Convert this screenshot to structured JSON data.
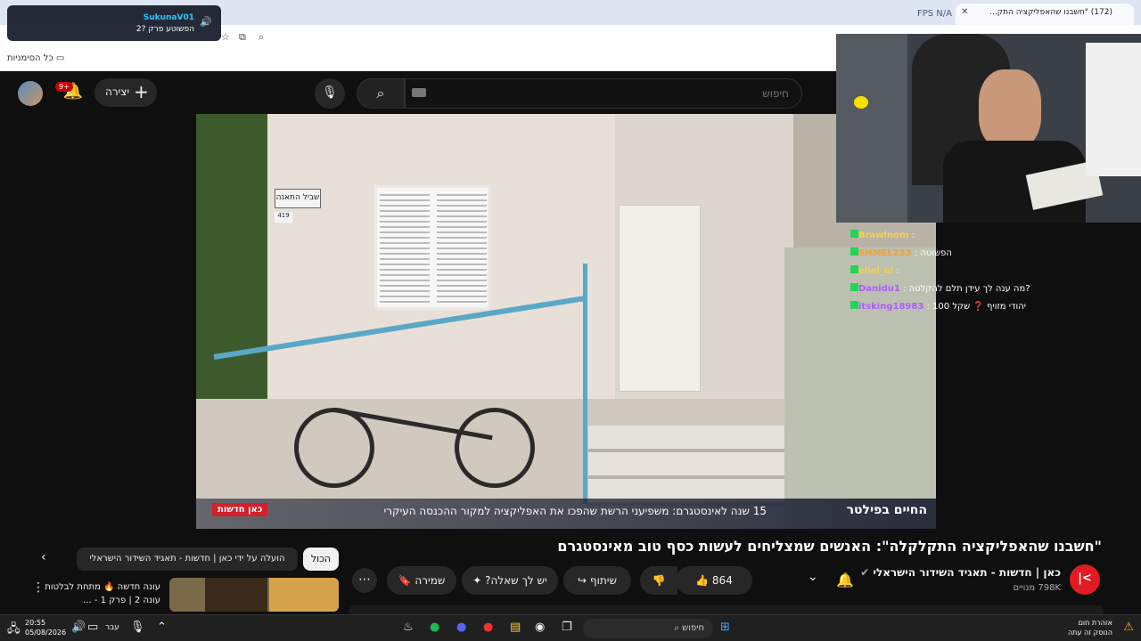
{
  "browser": {
    "tab_title": "(172) \"חשבנו שהאפליקציה התק...",
    "fps_label": "FPS",
    "fps_value": "N/A",
    "bookmarks_label": "כל הסימניות"
  },
  "stream_widget": {
    "username": "SukunaV01",
    "message": "הפשוטע פרק ?2"
  },
  "header": {
    "search_placeholder": "חיפוש",
    "create_label": "יצירה",
    "notif_count": "9+"
  },
  "video": {
    "lower_third_show": "החיים בפילטר",
    "lower_third_headline": "15 שנה לאינסטגרם: משפיעני הרשת שהפכו את האפליקציה למקור ההכנסה העיקרי",
    "brand_tag": "כאן חדשות",
    "sign_text": "שביל התאנה",
    "house_number": "419"
  },
  "chat": [
    {
      "user": "Brawlnom",
      "text": "",
      "color": "#f2d24b"
    },
    {
      "user": "SHMEL233",
      "text": "הפשוטה",
      "color": "#f2a03a"
    },
    {
      "user": "eliel_el",
      "text": "",
      "color": "#f2d24b"
    },
    {
      "user": "Danidu1",
      "text": "מה ענה לך עידן תלם להקלטה?",
      "color": "#b05bff"
    },
    {
      "user": "itsking18983",
      "text": "100 יהודי מזויף ❓ שקל",
      "color": "#b05bff"
    }
  ],
  "watch": {
    "title": "\"חשבנו שהאפליקציה התקלקלה\": האנשים שמצליחים לעשות כסף טוב מאינסטגרם",
    "channel_name": "כאן | חדשות - תאגיד השידור הישראלי",
    "subscribers": "798K מנויים",
    "likes": "864",
    "share_label": "שיתוף",
    "ask_label": "יש לך שאלה?",
    "save_label": "שמירה"
  },
  "chips": {
    "all": "הכול",
    "uploaded_by": "הועלה על ידי כאן | חדשות - תאגיד השידור הישראלי"
  },
  "recommended": {
    "title": "עונה חדשה 🔥 מתחת לבלטות עונה 2 | פרק 1 - ..."
  },
  "taskbar": {
    "search_placeholder": "חיפוש",
    "time": "20:55",
    "date": "05/08/2026",
    "lang": "עבר",
    "weather_title": "אזהרת חום",
    "weather_sub": "הנוסק זה עתה"
  }
}
